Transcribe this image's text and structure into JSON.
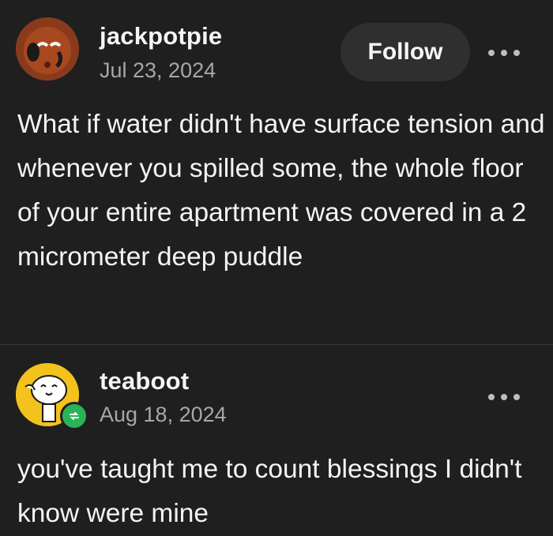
{
  "posts": [
    {
      "username": "jackpotpie",
      "date": "Jul 23, 2024",
      "follow_label": "Follow",
      "body": "What if water didn't have surface tension and whenever you spilled some, the whole floor of your entire apartment was covered in a 2 micrometer deep puddle",
      "avatar_icon": "clown-avatar-icon",
      "more_icon": "more-options-icon"
    },
    {
      "username": "teaboot",
      "date": "Aug 18, 2024",
      "body": "you've taught me to count blessings I didn't know were mine",
      "avatar_icon": "cartoon-face-avatar-icon",
      "badge_icon": "reblog-icon",
      "more_icon": "more-options-icon"
    }
  ],
  "colors": {
    "background": "#1f1f1f",
    "follow_button": "#2f2f2f",
    "reblog_badge": "#2bb357",
    "muted_text": "#a7a7a7"
  }
}
